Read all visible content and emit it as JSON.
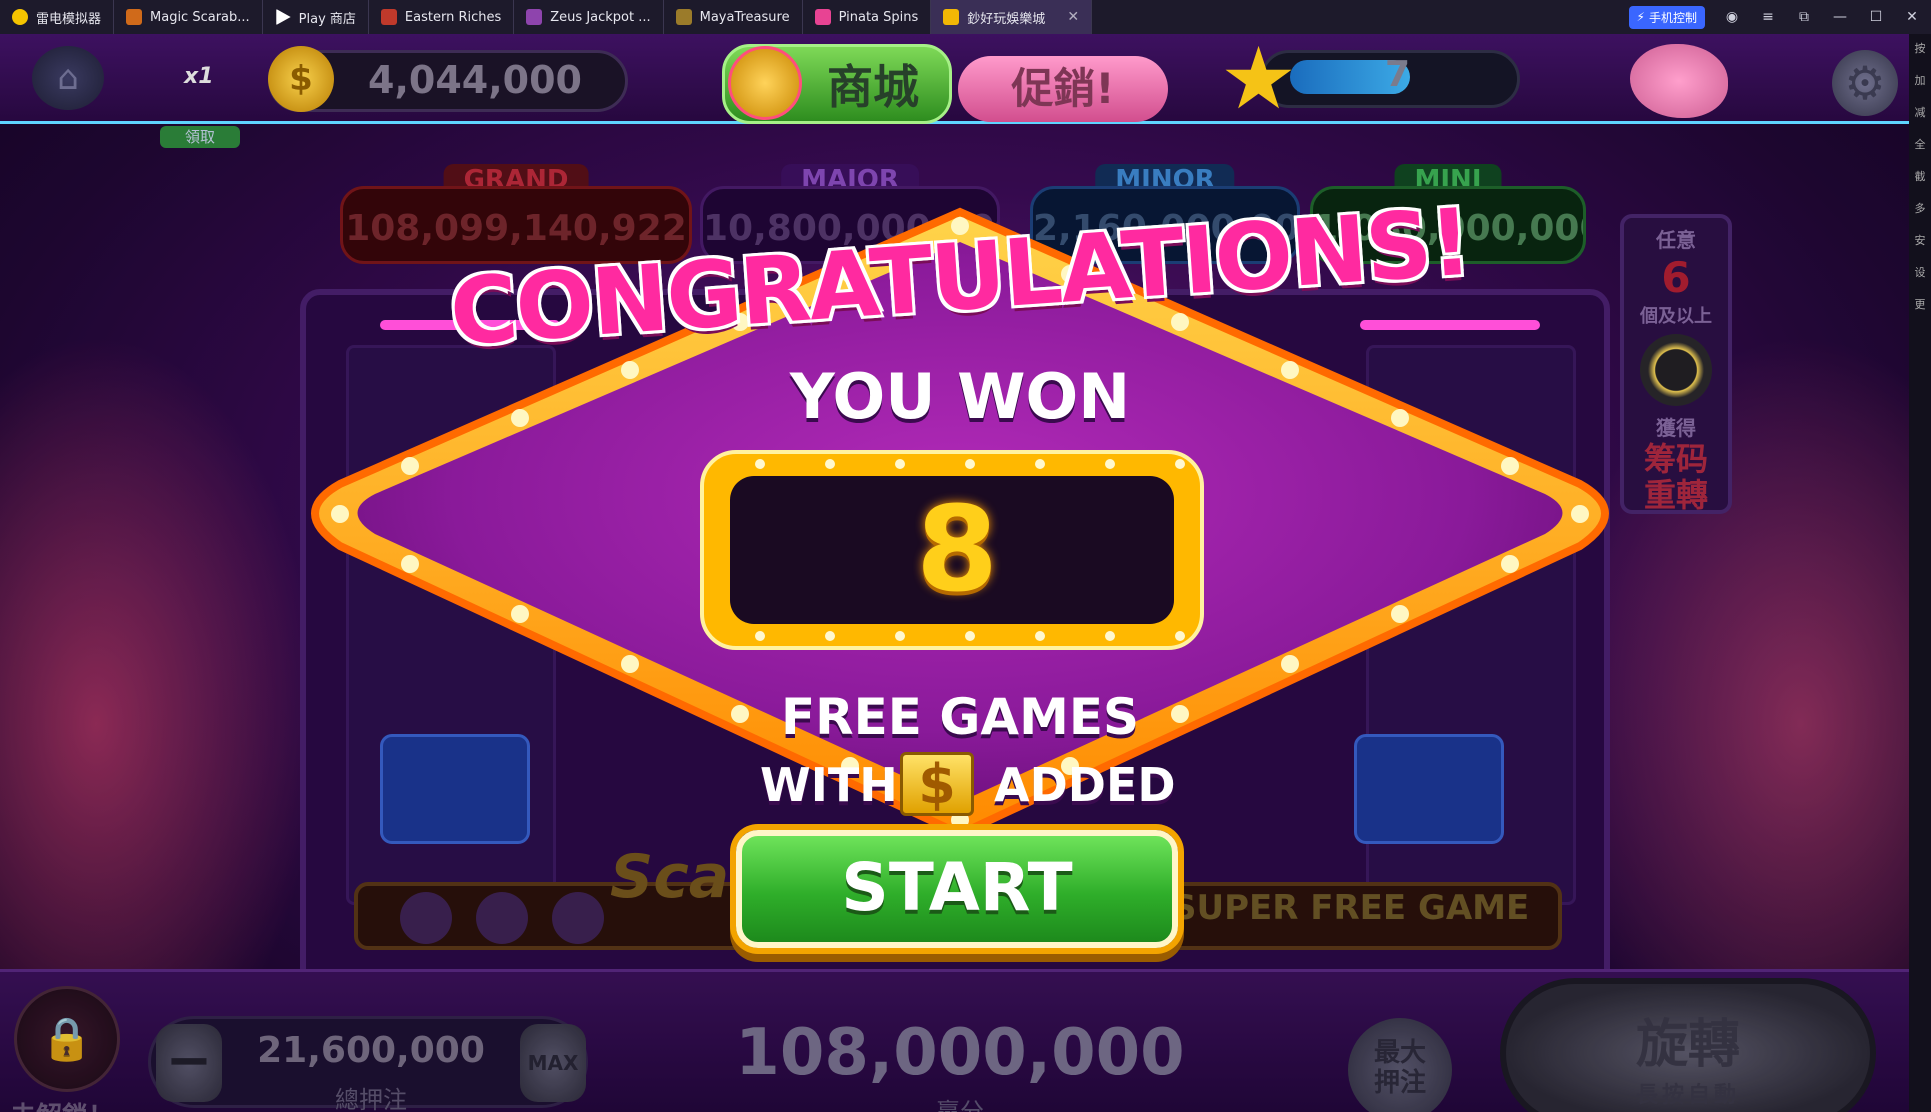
{
  "tabs": [
    {
      "label": "雷电模拟器",
      "icon": "ldplayer-icon",
      "color": "#f5c400"
    },
    {
      "label": "Magic Scarab...",
      "icon": "scarab-game-icon",
      "color": "#d06a1a"
    },
    {
      "label": "Play 商店",
      "icon": "play-store-icon",
      "color": "#3ddc84"
    },
    {
      "label": "Eastern Riches",
      "icon": "eastern-riches-icon",
      "color": "#c0392b"
    },
    {
      "label": "Zeus Jackpot ...",
      "icon": "zeus-icon",
      "color": "#8e44ad"
    },
    {
      "label": "MayaTreasure",
      "icon": "maya-icon",
      "color": "#9b7b2a"
    },
    {
      "label": "Pinata Spins",
      "icon": "pinata-icon",
      "color": "#e84393"
    },
    {
      "label": "鈔好玩娛樂城",
      "icon": "casino-icon",
      "color": "#f2b705",
      "active": true
    }
  ],
  "window": {
    "phone_control": "手机控制"
  },
  "sidebar": [
    "按",
    "加",
    "减",
    "全",
    "截",
    "多",
    "安",
    "设",
    "更"
  ],
  "hud": {
    "multiplier": "x1",
    "claim": "領取",
    "coins": "4,044,000",
    "shop": "商城",
    "promo": "促銷!",
    "level": "7"
  },
  "jackpots": {
    "grand_label": "GRAND",
    "grand_value": "108,099,140,922",
    "major_label": "MAJOR",
    "major_value": "10,800,000,000",
    "minor_label": "MINOR",
    "minor_value": "2,160,000,000",
    "mini_label": "MINI",
    "mini_value": "1,080,000,000"
  },
  "side_panel": {
    "t1": "任意",
    "six": "6",
    "t2": "個及以上",
    "t3": "獲得",
    "t4a": "筹码",
    "t4b": "重轉"
  },
  "reels": {
    "super_free": "SUPER FREE GAME",
    "scatter": "Scat"
  },
  "modal": {
    "congrats": "CONGRATULATIONS!",
    "you_won": "YOU WON",
    "count": "8",
    "free_games": "FREE GAMES",
    "with": "WITH",
    "symbol": "$",
    "added": "ADDED",
    "start": "START"
  },
  "bottom": {
    "unlock": "未解鎖！",
    "bet_value": "21,600,000",
    "bet_label": "總押注",
    "minus": "−",
    "max": "MAX",
    "win_value": "108,000,000",
    "win_label": "贏分",
    "max_bet_1": "最大",
    "max_bet_2": "押注",
    "spin_1": "旋轉",
    "spin_2": "長按自動"
  }
}
